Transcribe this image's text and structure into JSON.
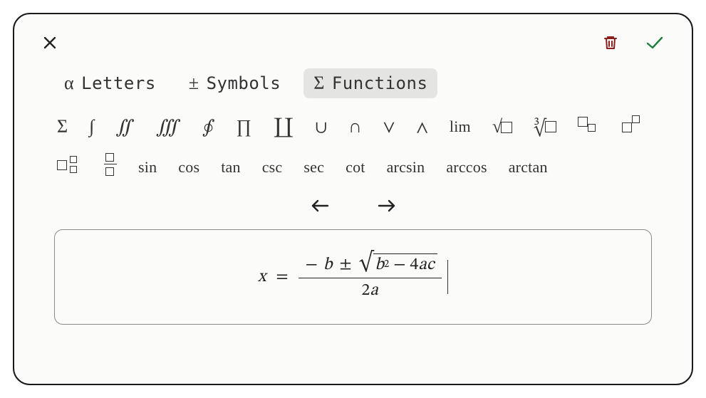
{
  "tabs": [
    {
      "glyph": "α",
      "label": "Letters",
      "active": false
    },
    {
      "glyph": "±",
      "label": "Symbols",
      "active": false
    },
    {
      "glyph": "Σ",
      "label": "Functions",
      "active": true
    }
  ],
  "palette_row1": [
    {
      "name": "sum",
      "glyph": "Σ"
    },
    {
      "name": "int",
      "glyph": "∫"
    },
    {
      "name": "iint",
      "glyph": "∬"
    },
    {
      "name": "iiint",
      "glyph": "∭"
    },
    {
      "name": "oint",
      "glyph": "∮"
    },
    {
      "name": "prod",
      "glyph": "∏"
    },
    {
      "name": "coprod",
      "glyph": "∐"
    },
    {
      "name": "bigcup",
      "glyph": "∪"
    },
    {
      "name": "bigcap",
      "glyph": "∩"
    },
    {
      "name": "bigvee",
      "glyph": "∨"
    },
    {
      "name": "bigwedge",
      "glyph": "∧"
    },
    {
      "name": "lim",
      "glyph": "lim",
      "word": true
    }
  ],
  "palette_row2_words": [
    {
      "name": "sin",
      "glyph": "sin"
    },
    {
      "name": "cos",
      "glyph": "cos"
    },
    {
      "name": "tan",
      "glyph": "tan"
    },
    {
      "name": "csc",
      "glyph": "csc"
    },
    {
      "name": "sec",
      "glyph": "sec"
    },
    {
      "name": "cot",
      "glyph": "cot"
    },
    {
      "name": "arcsin",
      "glyph": "arcsin"
    },
    {
      "name": "arccos",
      "glyph": "arccos"
    },
    {
      "name": "arctan",
      "glyph": "arctan"
    }
  ],
  "formula": {
    "lhs_var": "x",
    "eq": "=",
    "minus": "−",
    "b": "b",
    "pm": "±",
    "b2": "b",
    "sq": "2",
    "minus2": "−",
    "four": "4",
    "a": "a",
    "c": "c",
    "two": "2",
    "a2": "a"
  }
}
